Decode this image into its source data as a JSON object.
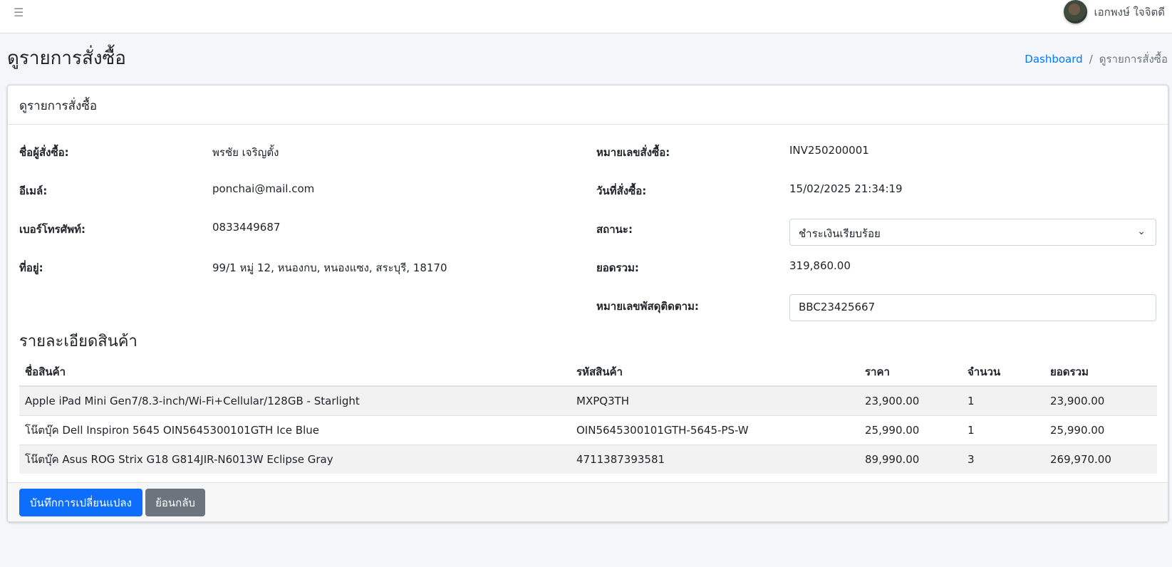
{
  "header": {
    "user_name": "เอกพงษ์ ใจจิตดี"
  },
  "page": {
    "title": "ดูรายการสั่งซื้อ",
    "breadcrumb": [
      {
        "label": "Dashboard"
      },
      {
        "label": "ดูรายการสั่งซื้อ"
      }
    ]
  },
  "card": {
    "title": "ดูรายการสั่งซื้อ",
    "customer": {
      "name_label": "ชื่อผู้สั่งซื้อ:",
      "name": "พรชัย เจริญตั้ง",
      "email_label": "อีเมล์:",
      "email": "ponchai@mail.com",
      "phone_label": "เบอร์โทรศัพท์:",
      "phone": "0833449687",
      "address_label": "ที่อยู่:",
      "address": "99/1 หมู่ 12, หนองกบ, หนองแซง, สระบุรี, 18170"
    },
    "order": {
      "invoice_label": "หมายเลขสั่งซื้อ:",
      "invoice": "INV250200001",
      "date_label": "วันที่สั่งซื้อ:",
      "date": "15/02/2025 21:34:19",
      "status_label": "สถานะ:",
      "status": "ชำระเงินเรียบร้อย",
      "total_label": "ยอดรวม:",
      "total": "319,860.00",
      "tracking_label": "หมายเลขพัสดุติดตาม:",
      "tracking": "BBC23425667"
    },
    "products_title": "รายละเอียดสินค้า",
    "table": {
      "headers": [
        "ชื่อสินค้า",
        "รหัสสินค้า",
        "ราคา",
        "จำนวน",
        "ยอดรวม"
      ],
      "rows": [
        [
          "Apple iPad Mini Gen7/8.3-inch/Wi-Fi+Cellular/128GB - Starlight",
          "MXPQ3TH",
          "23,900.00",
          "1",
          "23,900.00"
        ],
        [
          "โน๊ตบุ๊ค Dell Inspiron 5645 OIN5645300101GTH Ice Blue",
          "OIN5645300101GTH-5645-PS-W",
          "25,990.00",
          "1",
          "25,990.00"
        ],
        [
          "โน๊ตบุ๊ค Asus ROG Strix G18 G814JIR-N6013W Eclipse Gray",
          "4711387393581",
          "89,990.00",
          "3",
          "269,970.00"
        ]
      ]
    },
    "buttons": {
      "save": "บันทึกการเปลี่ยนแปลง",
      "back": "ย้อนกลับ"
    }
  },
  "icons": {
    "menu": "hamburger-icon",
    "select": "chevron-down-icon"
  }
}
